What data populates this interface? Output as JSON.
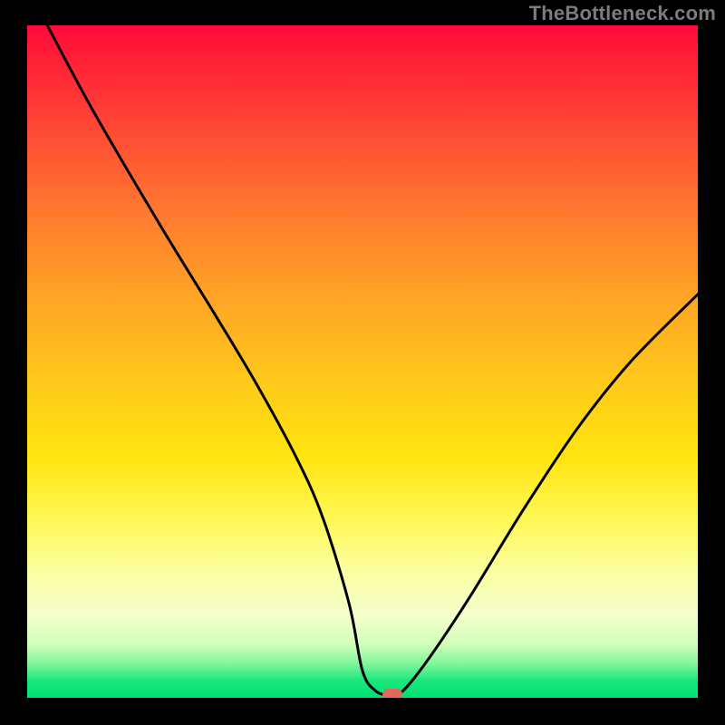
{
  "watermark": "TheBottleneck.com",
  "chart_data": {
    "type": "line",
    "title": "",
    "xlabel": "",
    "ylabel": "",
    "xlim": [
      0,
      100
    ],
    "ylim": [
      0,
      100
    ],
    "grid": false,
    "legend": false,
    "series": [
      {
        "name": "bottleneck-curve",
        "x": [
          3,
          10,
          20,
          28,
          34,
          40,
          44,
          48,
          50,
          52,
          54,
          56,
          60,
          66,
          74,
          82,
          90,
          100
        ],
        "y": [
          100,
          87,
          70,
          57,
          47,
          36,
          27,
          14,
          4,
          1,
          0.5,
          1,
          6,
          15,
          28,
          40,
          50,
          60
        ]
      }
    ],
    "marker": {
      "x": 54.5,
      "y": 0.5,
      "color": "#e26a5d"
    },
    "background_gradient": {
      "top": "#ff0a3a",
      "bottom": "#03e072",
      "stops": [
        "#ff0a3a",
        "#ff2336",
        "#ff4b34",
        "#ff7a2f",
        "#ffa326",
        "#ffc61b",
        "#ffe50f",
        "#fff85a",
        "#fbffa7",
        "#f3ffcd",
        "#d1ffb9",
        "#7ef59c",
        "#18e77c",
        "#03e072"
      ]
    }
  }
}
